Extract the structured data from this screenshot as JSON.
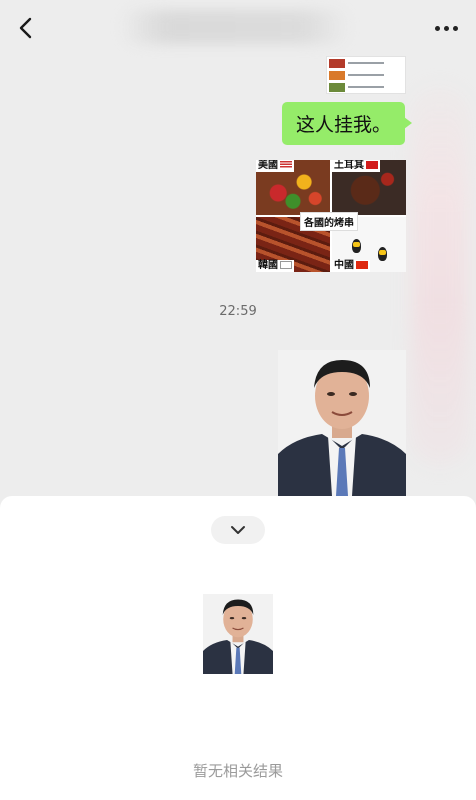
{
  "header": {
    "back_icon": "chevron-left-icon",
    "more_icon": "more-horizontal-icon"
  },
  "messages": {
    "text_bubble": "这人挂我。",
    "meme": {
      "labels": [
        "美國",
        "土耳其",
        "韓國",
        "中國"
      ],
      "caption": "各國的烤串"
    },
    "timestamp": "22:59"
  },
  "sheet": {
    "collapse_icon": "chevron-down-icon",
    "empty_text": "暂无相关结果"
  },
  "colors": {
    "background": "#ededed",
    "bubble": "#95ec69",
    "sheet": "#ffffff",
    "muted_text": "#9b9b9b"
  }
}
